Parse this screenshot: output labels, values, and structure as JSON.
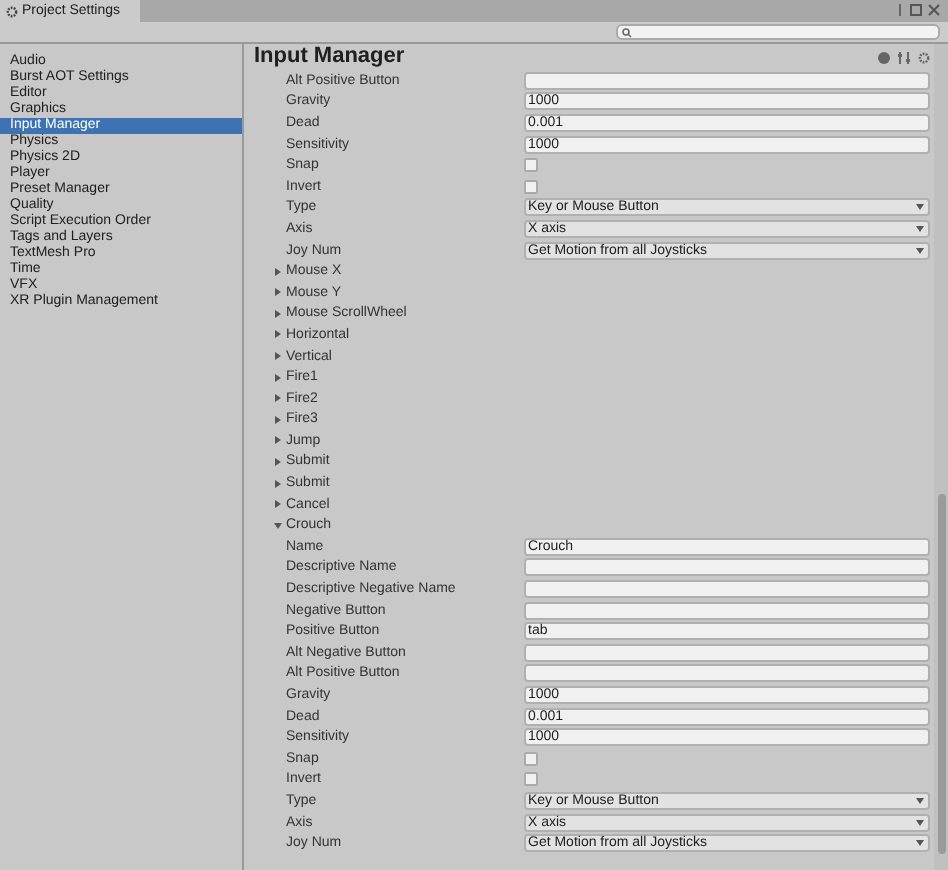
{
  "window": {
    "title": "Project Settings"
  },
  "sidebar": {
    "items": [
      {
        "label": "Audio",
        "selected": false
      },
      {
        "label": "Burst AOT Settings",
        "selected": false
      },
      {
        "label": "Editor",
        "selected": false
      },
      {
        "label": "Graphics",
        "selected": false
      },
      {
        "label": "Input Manager",
        "selected": true
      },
      {
        "label": "Physics",
        "selected": false
      },
      {
        "label": "Physics 2D",
        "selected": false
      },
      {
        "label": "Player",
        "selected": false
      },
      {
        "label": "Preset Manager",
        "selected": false
      },
      {
        "label": "Quality",
        "selected": false
      },
      {
        "label": "Script Execution Order",
        "selected": false
      },
      {
        "label": "Tags and Layers",
        "selected": false
      },
      {
        "label": "TextMesh Pro",
        "selected": false
      },
      {
        "label": "Time",
        "selected": false
      },
      {
        "label": "VFX",
        "selected": false
      },
      {
        "label": "XR Plugin Management",
        "selected": false
      }
    ]
  },
  "page": {
    "title": "Input Manager"
  },
  "properties": [
    {
      "label": "Alt Positive Button",
      "kind": "text"
    },
    {
      "label": "Gravity",
      "kind": "text",
      "value": "1000"
    },
    {
      "label": "Dead",
      "kind": "text",
      "value": "0.001"
    },
    {
      "label": "Sensitivity",
      "kind": "text",
      "value": "1000"
    },
    {
      "label": "Snap",
      "kind": "checkbox",
      "checked": false
    },
    {
      "label": "Invert",
      "kind": "checkbox",
      "checked": false
    },
    {
      "label": "Type",
      "kind": "dropdown",
      "value": "Key or Mouse Button"
    },
    {
      "label": "Axis",
      "kind": "dropdown",
      "value": "X axis"
    },
    {
      "label": "Joy Num",
      "kind": "dropdown",
      "value": "Get Motion from all Joysticks"
    }
  ],
  "axes": [
    {
      "name": "Mouse X",
      "expanded": false
    },
    {
      "name": "Mouse Y",
      "expanded": false
    },
    {
      "name": "Mouse ScrollWheel",
      "expanded": false
    },
    {
      "name": "Horizontal",
      "expanded": false
    },
    {
      "name": "Vertical",
      "expanded": false
    },
    {
      "name": "Fire1",
      "expanded": false
    },
    {
      "name": "Fire2",
      "expanded": false
    },
    {
      "name": "Fire3",
      "expanded": false
    },
    {
      "name": "Jump",
      "expanded": false
    },
    {
      "name": "Submit",
      "expanded": false
    },
    {
      "name": "Submit",
      "expanded": false
    },
    {
      "name": "Cancel",
      "expanded": false
    },
    {
      "name": "Crouch",
      "expanded": true,
      "properties": [
        {
          "label": "Name",
          "kind": "text",
          "value": "Crouch"
        },
        {
          "label": "Descriptive Name",
          "kind": "text"
        },
        {
          "label": "Descriptive Negative Name",
          "kind": "text"
        },
        {
          "label": "Negative Button",
          "kind": "text"
        },
        {
          "label": "Positive Button",
          "kind": "text",
          "value": "tab"
        },
        {
          "label": "Alt Negative Button",
          "kind": "text"
        },
        {
          "label": "Alt Positive Button",
          "kind": "text"
        },
        {
          "label": "Gravity",
          "kind": "text",
          "value": "1000"
        },
        {
          "label": "Dead",
          "kind": "text",
          "value": "0.001"
        },
        {
          "label": "Sensitivity",
          "kind": "text",
          "value": "1000"
        },
        {
          "label": "Snap",
          "kind": "checkbox",
          "checked": false
        },
        {
          "label": "Invert",
          "kind": "checkbox",
          "checked": false
        },
        {
          "label": "Type",
          "kind": "dropdown",
          "value": "Key or Mouse Button"
        },
        {
          "label": "Axis",
          "kind": "dropdown",
          "value": "X axis"
        },
        {
          "label": "Joy Num",
          "kind": "dropdown",
          "value": "Get Motion from all Joysticks"
        }
      ]
    }
  ]
}
